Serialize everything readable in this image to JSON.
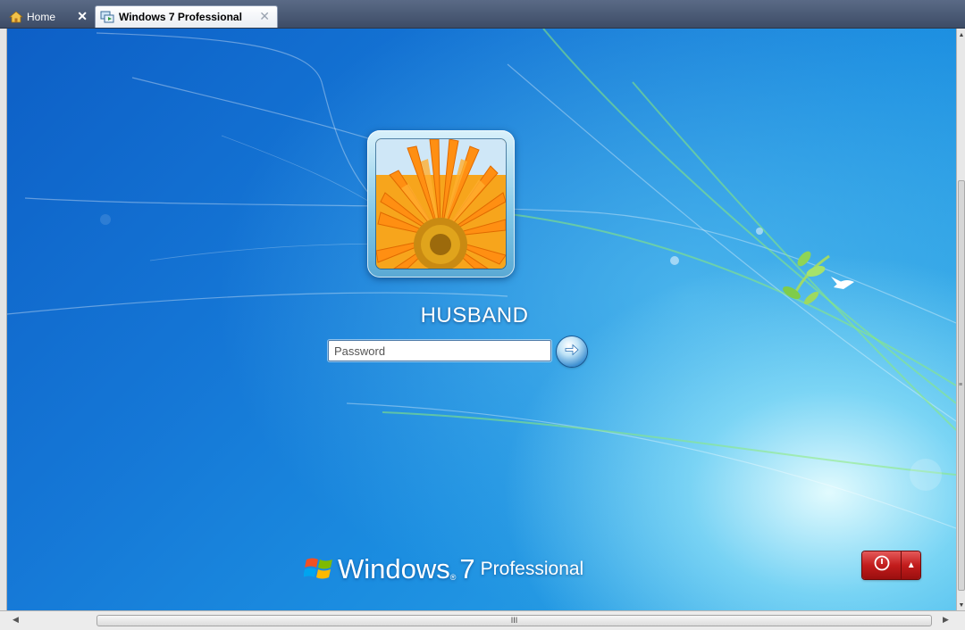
{
  "tabs": [
    {
      "label": "Home",
      "icon": "home-icon",
      "close": "✕"
    },
    {
      "label": "Windows 7 Professional",
      "icon": "vm-icon",
      "close": "✕",
      "active": true
    }
  ],
  "login": {
    "username": "HUSBAND",
    "password_placeholder": "Password",
    "avatar": "orange-gerbera-flower"
  },
  "branding": {
    "windows": "Windows",
    "version": "7",
    "edition": "Professional",
    "mark": "®"
  },
  "power": {
    "icon": "power-icon",
    "menu_arrow": "▲"
  },
  "scrollbar": {
    "grip": "III"
  },
  "colors": {
    "desktop_blue": "#1577d6",
    "power_red": "#c21c1c"
  }
}
